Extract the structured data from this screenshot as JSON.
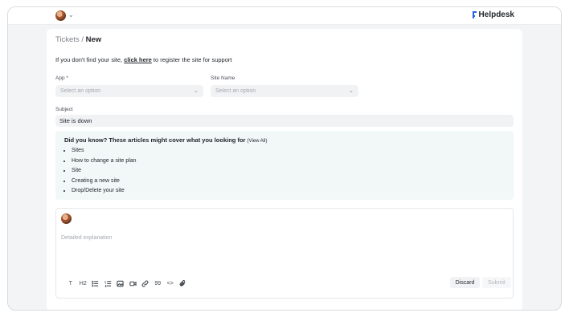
{
  "topbar": {
    "brand": "Helpdesk",
    "user_chevron": "⌄"
  },
  "breadcrumb": {
    "parent": "Tickets",
    "separator": " / ",
    "current": "New"
  },
  "notice": {
    "before": "If you don't find your site, ",
    "link": "click here",
    "after": " to register the site for support"
  },
  "form": {
    "app_label": "App *",
    "app_placeholder": "Select an option",
    "site_label": "Site Name",
    "site_placeholder": "Select an option",
    "subject_label": "Subject",
    "subject_value": "Site is down"
  },
  "articles": {
    "heading": "Did you know? These articles might cover what you looking for ",
    "view_all": "(View All)",
    "items": [
      "Sites",
      "How to change a site plan",
      "Site",
      "Creating a new site",
      "Drop/Delete your site"
    ]
  },
  "editor": {
    "placeholder": "Detailed explanation",
    "toolbar": {
      "text": "T",
      "heading": "H2",
      "quote": "99",
      "code": "<>"
    },
    "discard_label": "Discard",
    "submit_label": "Submit"
  },
  "icons": [
    "chevron-down-icon",
    "helpdesk-logo-icon",
    "text-icon",
    "heading-icon",
    "bullet-list-icon",
    "numbered-list-icon",
    "image-icon",
    "video-icon",
    "link-icon",
    "quote-icon",
    "code-icon",
    "attachment-icon"
  ]
}
